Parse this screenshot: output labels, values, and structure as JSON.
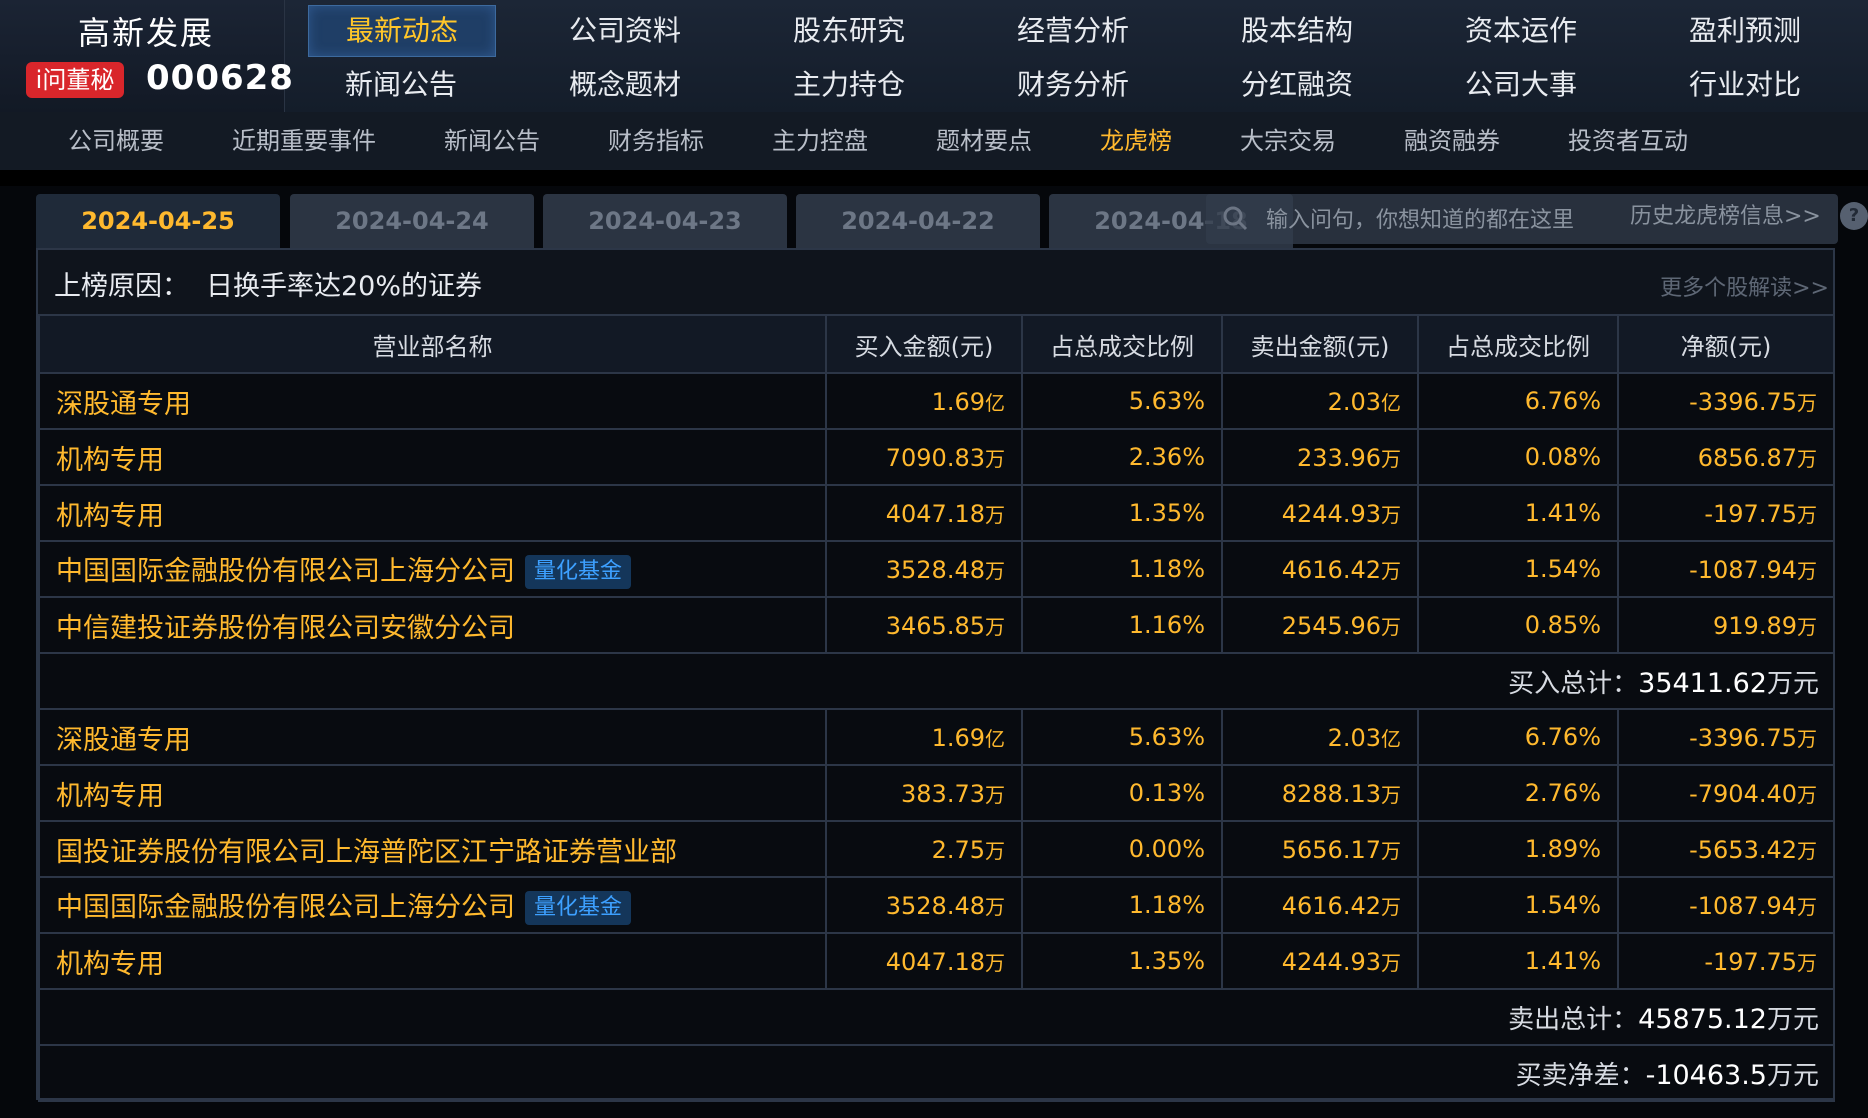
{
  "header": {
    "company_name": "高新发展",
    "badge": "i问董秘",
    "code": "000628",
    "menu_top": [
      "最新动态",
      "公司资料",
      "股东研究",
      "经营分析",
      "股本结构",
      "资本运作",
      "盈利预测"
    ],
    "menu_bottom": [
      "新闻公告",
      "概念题材",
      "主力持仓",
      "财务分析",
      "分红融资",
      "公司大事",
      "行业对比"
    ],
    "active_menu": "最新动态"
  },
  "subnav": {
    "items": [
      "公司概要",
      "近期重要事件",
      "新闻公告",
      "财务指标",
      "主力控盘",
      "题材要点",
      "龙虎榜",
      "大宗交易",
      "融资融券",
      "投资者互动"
    ],
    "active": "龙虎榜"
  },
  "tabs": [
    "2024-04-25",
    "2024-04-24",
    "2024-04-23",
    "2024-04-22",
    "2024-04-18"
  ],
  "active_tab": "2024-04-25",
  "search": {
    "placeholder": "输入问句，你想知道的都在这里",
    "history_link": "历史龙虎榜信息>>"
  },
  "reason": {
    "label": "上榜原因：",
    "text": "日换手率达20%的证券",
    "more_link": "更多个股解读>>"
  },
  "columns": [
    "营业部名称",
    "买入金额(元)",
    "占总成交比例",
    "卖出金额(元)",
    "占总成交比例",
    "净额(元)"
  ],
  "buy_rows": [
    {
      "name": "深股通专用",
      "tag": "",
      "buy": "1.69",
      "buy_unit": "亿",
      "buy_pct": "5.63%",
      "sell": "2.03",
      "sell_unit": "亿",
      "sell_pct": "6.76%",
      "net": "-3396.75",
      "net_unit": "万"
    },
    {
      "name": "机构专用",
      "tag": "",
      "buy": "7090.83",
      "buy_unit": "万",
      "buy_pct": "2.36%",
      "sell": "233.96",
      "sell_unit": "万",
      "sell_pct": "0.08%",
      "net": "6856.87",
      "net_unit": "万"
    },
    {
      "name": "机构专用",
      "tag": "",
      "buy": "4047.18",
      "buy_unit": "万",
      "buy_pct": "1.35%",
      "sell": "4244.93",
      "sell_unit": "万",
      "sell_pct": "1.41%",
      "net": "-197.75",
      "net_unit": "万"
    },
    {
      "name": "中国国际金融股份有限公司上海分公司",
      "tag": "量化基金",
      "buy": "3528.48",
      "buy_unit": "万",
      "buy_pct": "1.18%",
      "sell": "4616.42",
      "sell_unit": "万",
      "sell_pct": "1.54%",
      "net": "-1087.94",
      "net_unit": "万"
    },
    {
      "name": "中信建投证券股份有限公司安徽分公司",
      "tag": "",
      "buy": "3465.85",
      "buy_unit": "万",
      "buy_pct": "1.16%",
      "sell": "2545.96",
      "sell_unit": "万",
      "sell_pct": "0.85%",
      "net": "919.89",
      "net_unit": "万"
    }
  ],
  "buy_total": {
    "label": "买入总计：",
    "value": "35411.62",
    "unit": "万元"
  },
  "sell_rows": [
    {
      "name": "深股通专用",
      "tag": "",
      "buy": "1.69",
      "buy_unit": "亿",
      "buy_pct": "5.63%",
      "sell": "2.03",
      "sell_unit": "亿",
      "sell_pct": "6.76%",
      "net": "-3396.75",
      "net_unit": "万"
    },
    {
      "name": "机构专用",
      "tag": "",
      "buy": "383.73",
      "buy_unit": "万",
      "buy_pct": "0.13%",
      "sell": "8288.13",
      "sell_unit": "万",
      "sell_pct": "2.76%",
      "net": "-7904.40",
      "net_unit": "万"
    },
    {
      "name": "国投证券股份有限公司上海普陀区江宁路证券营业部",
      "tag": "",
      "buy": "2.75",
      "buy_unit": "万",
      "buy_pct": "0.00%",
      "sell": "5656.17",
      "sell_unit": "万",
      "sell_pct": "1.89%",
      "net": "-5653.42",
      "net_unit": "万"
    },
    {
      "name": "中国国际金融股份有限公司上海分公司",
      "tag": "量化基金",
      "buy": "3528.48",
      "buy_unit": "万",
      "buy_pct": "1.18%",
      "sell": "4616.42",
      "sell_unit": "万",
      "sell_pct": "1.54%",
      "net": "-1087.94",
      "net_unit": "万"
    },
    {
      "name": "机构专用",
      "tag": "",
      "buy": "4047.18",
      "buy_unit": "万",
      "buy_pct": "1.35%",
      "sell": "4244.93",
      "sell_unit": "万",
      "sell_pct": "1.41%",
      "net": "-197.75",
      "net_unit": "万"
    }
  ],
  "sell_total": {
    "label": "卖出总计：",
    "value": "45875.12",
    "unit": "万元"
  },
  "net_total": {
    "label": "买卖净差：",
    "value": "-10463.5",
    "unit": "万元"
  },
  "colors": {
    "accent": "#ffb92e",
    "tag_text": "#3da0ff",
    "badge_red": "#d9262b",
    "border": "#2c3647"
  }
}
